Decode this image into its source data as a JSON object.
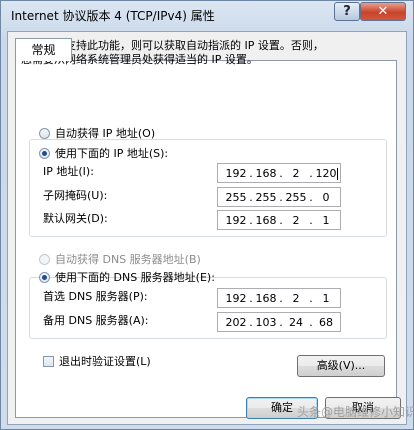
{
  "window": {
    "title": "Internet 协议版本 4 (TCP/IPv4) 属性",
    "help_label": "?",
    "close_label": "✕"
  },
  "tab": {
    "label": "常规"
  },
  "description": {
    "line1": "如果网络支持此功能，则可以获取自动指派的 IP 设置。否则，",
    "line2": "您需要从网络系统管理员处获得适当的 IP 设置。"
  },
  "ip_section": {
    "auto_label": "自动获得 IP 地址(O)",
    "manual_label": "使用下面的 IP 地址(S):",
    "ip_label": "IP 地址(I):",
    "mask_label": "子网掩码(U):",
    "gateway_label": "默认网关(D):",
    "ip": [
      "192",
      "168",
      "2",
      "120"
    ],
    "mask": [
      "255",
      "255",
      "255",
      "0"
    ],
    "gateway": [
      "192",
      "168",
      "2",
      "1"
    ],
    "selected": "manual"
  },
  "dns_section": {
    "auto_label": "自动获得 DNS 服务器地址(B)",
    "manual_label": "使用下面的 DNS 服务器地址(E):",
    "preferred_label": "首选 DNS 服务器(P):",
    "alternate_label": "备用 DNS 服务器(A):",
    "preferred": [
      "192",
      "168",
      "2",
      "1"
    ],
    "alternate": [
      "202",
      "103",
      "24",
      "68"
    ],
    "selected": "manual"
  },
  "validate": {
    "label": "退出时验证设置(L)",
    "checked": false
  },
  "buttons": {
    "advanced": "高级(V)...",
    "ok": "确定",
    "cancel": "取消"
  },
  "watermark": "头条@电脑维修小知识"
}
